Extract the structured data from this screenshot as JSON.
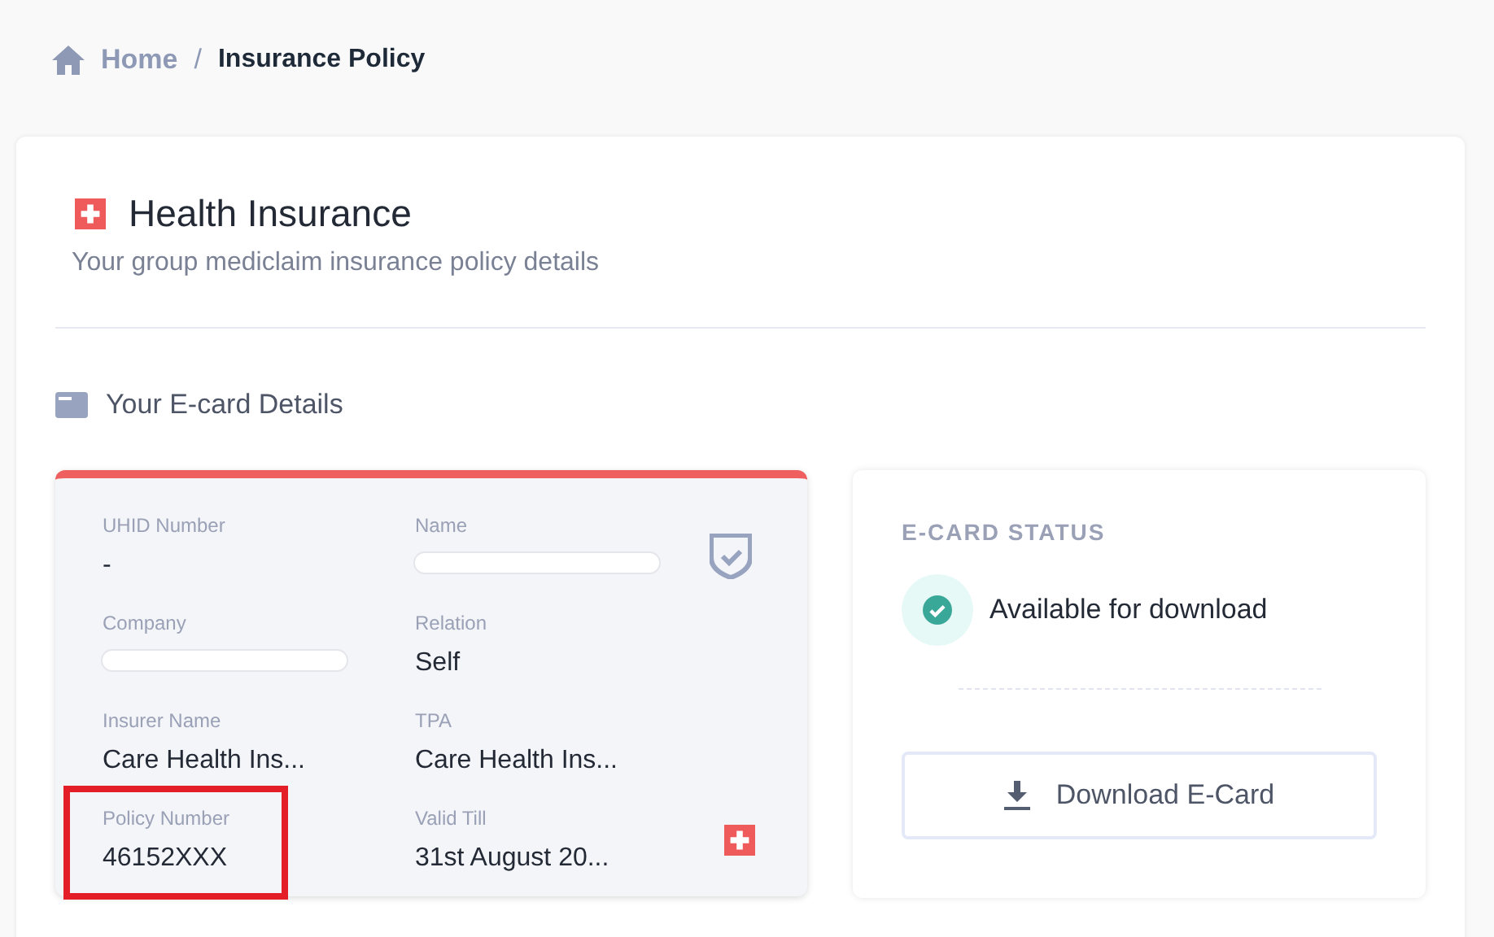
{
  "breadcrumb": {
    "home": "Home",
    "separator": "/",
    "current": "Insurance Policy"
  },
  "header": {
    "title": "Health Insurance",
    "subtitle": "Your group mediclaim insurance policy details"
  },
  "section": {
    "title": "Your E-card Details"
  },
  "ecard": {
    "fields": [
      {
        "label": "UHID Number",
        "value": "-",
        "redacted": false,
        "highlighted": false
      },
      {
        "label": "Name",
        "redacted": true,
        "highlighted": false
      },
      {
        "label": "Company",
        "redacted": true,
        "highlighted": false
      },
      {
        "label": "Relation",
        "value": "Self",
        "redacted": false,
        "highlighted": false
      },
      {
        "label": "Insurer Name",
        "value": "Care Health Ins...",
        "redacted": false,
        "highlighted": false
      },
      {
        "label": "TPA",
        "value": "Care Health Ins...",
        "redacted": false,
        "highlighted": false
      },
      {
        "label": "Policy Number",
        "value": "46152XXX",
        "redacted": false,
        "highlighted": true
      },
      {
        "label": "Valid Till",
        "value": "31st August 20...",
        "redacted": false,
        "highlighted": false
      }
    ]
  },
  "status": {
    "heading": "E-CARD STATUS",
    "text": "Available for download",
    "available": true,
    "button": "Download E-Card"
  }
}
